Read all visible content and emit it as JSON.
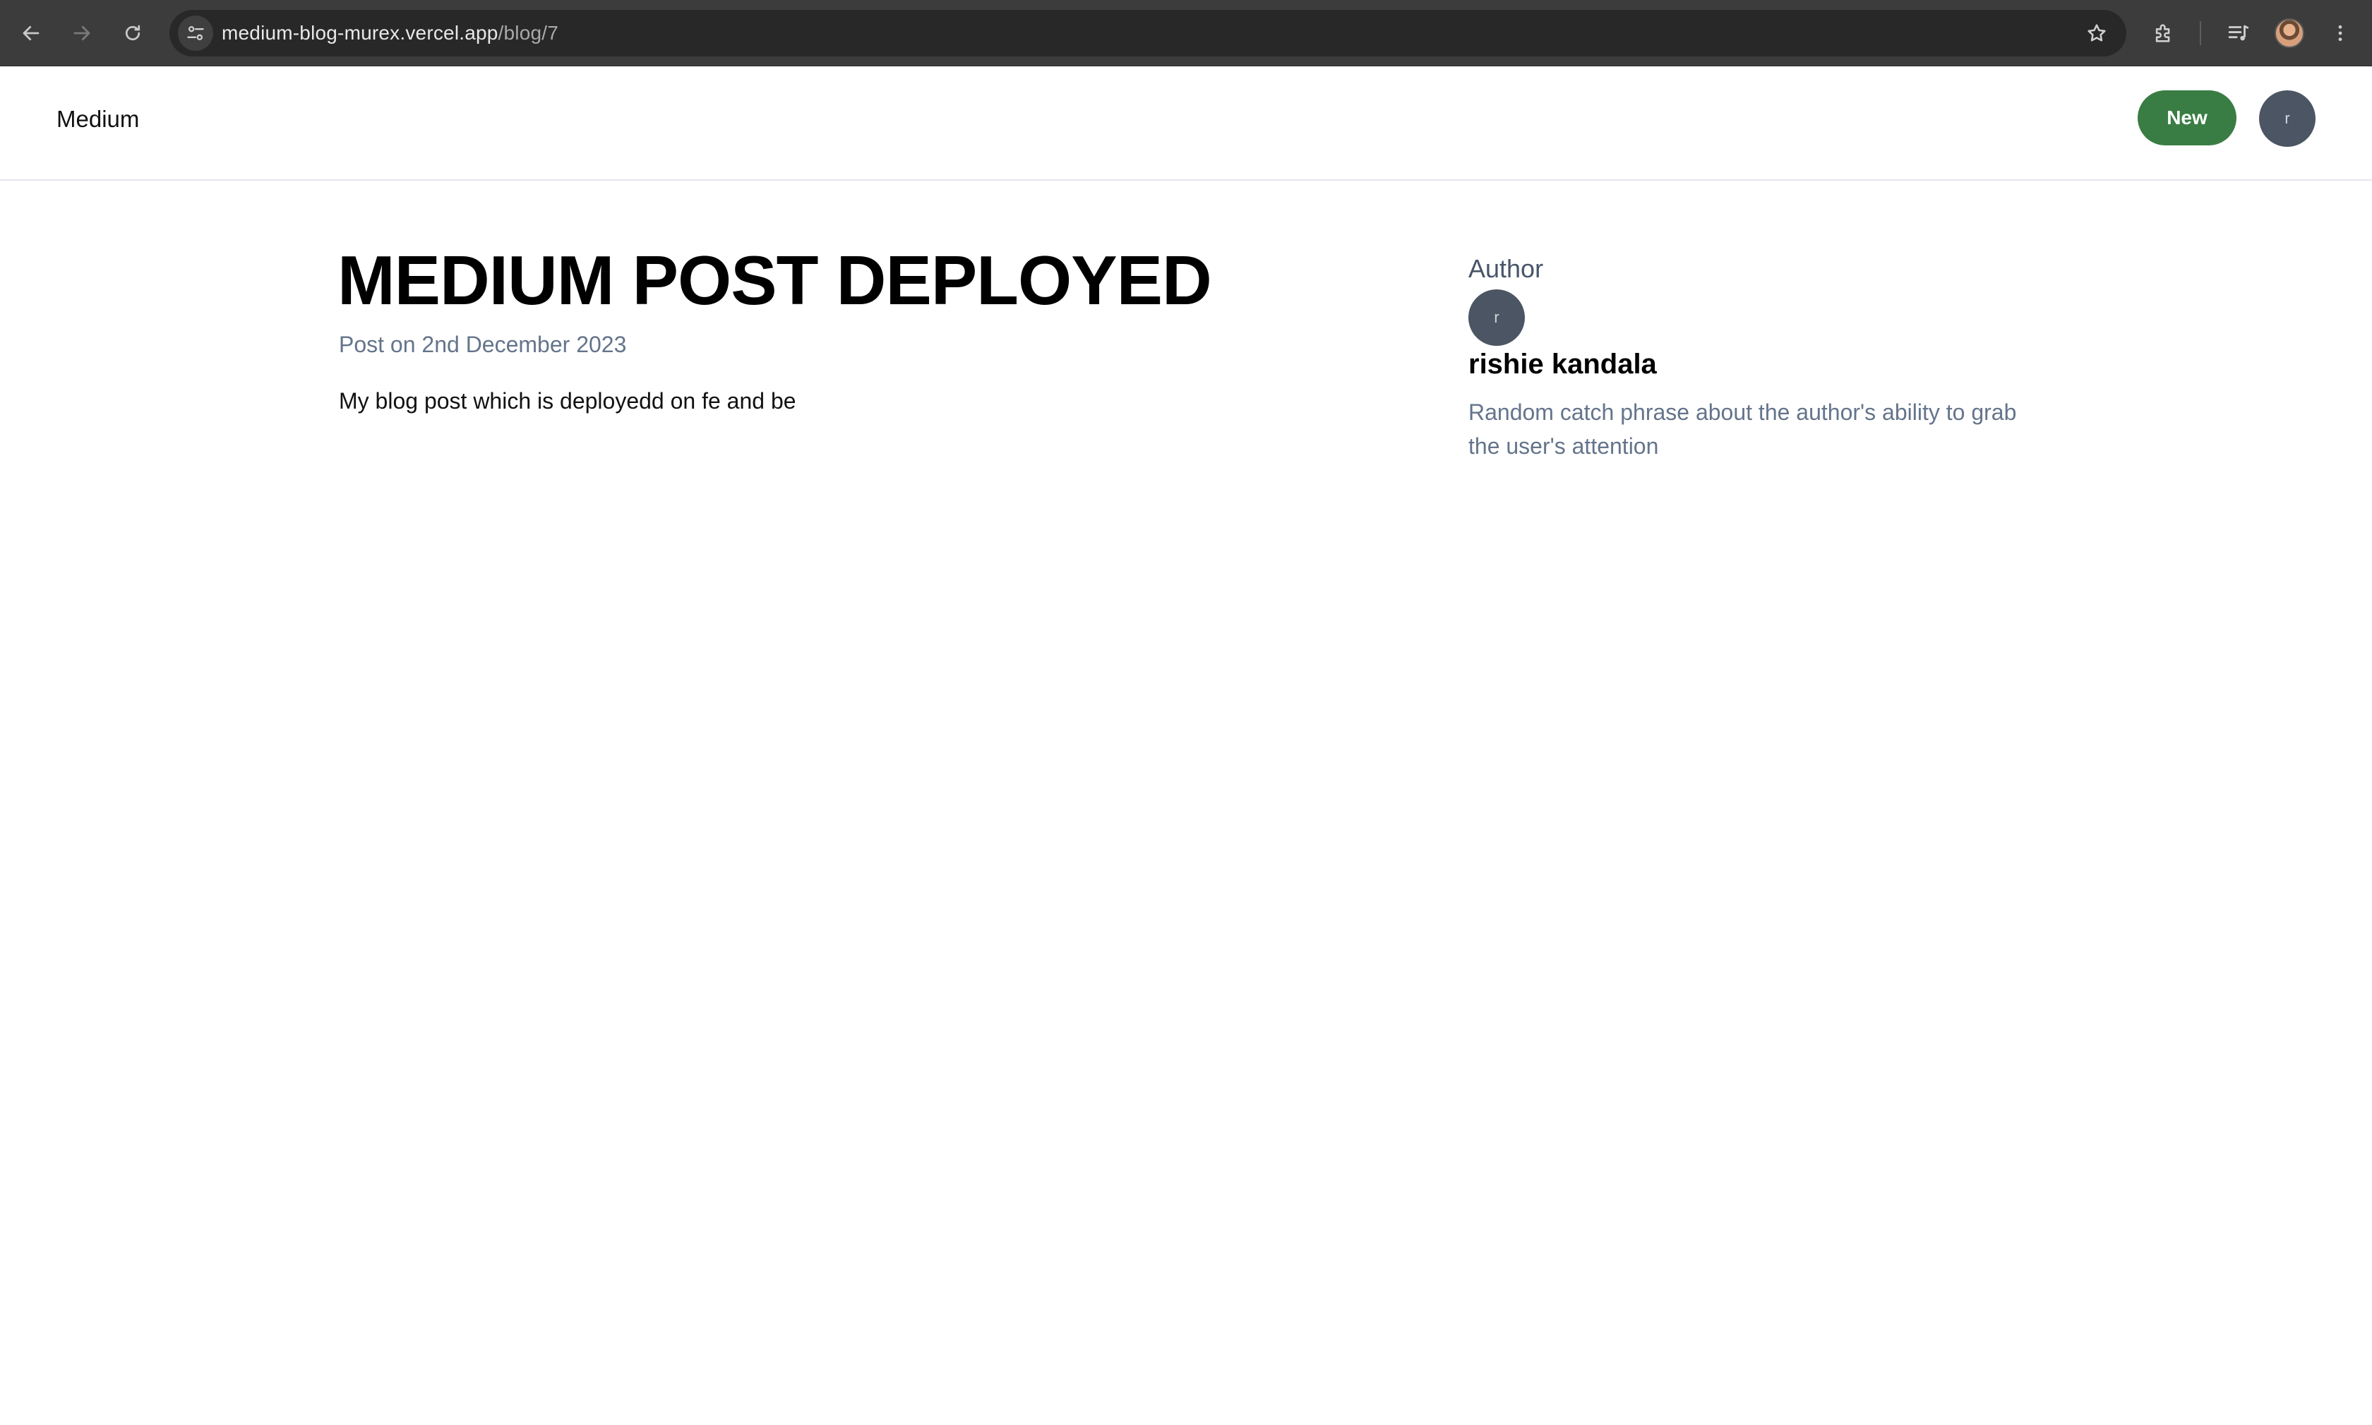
{
  "browser": {
    "url_host": "medium-blog-murex.vercel.app",
    "url_path": "/blog/7"
  },
  "header": {
    "brand": "Medium",
    "new_button_label": "New",
    "user_avatar_initial": "r",
    "accent_color": "#3a7d44"
  },
  "post": {
    "title": "MEDIUM POST DEPLOYED",
    "date": "Post on 2nd December 2023",
    "content": "My blog post which is deployedd on fe and be"
  },
  "author": {
    "heading": "Author",
    "avatar_initial": "r",
    "name": "rishie kandala",
    "bio": "Random catch phrase about the author's ability to grab the user's attention"
  }
}
